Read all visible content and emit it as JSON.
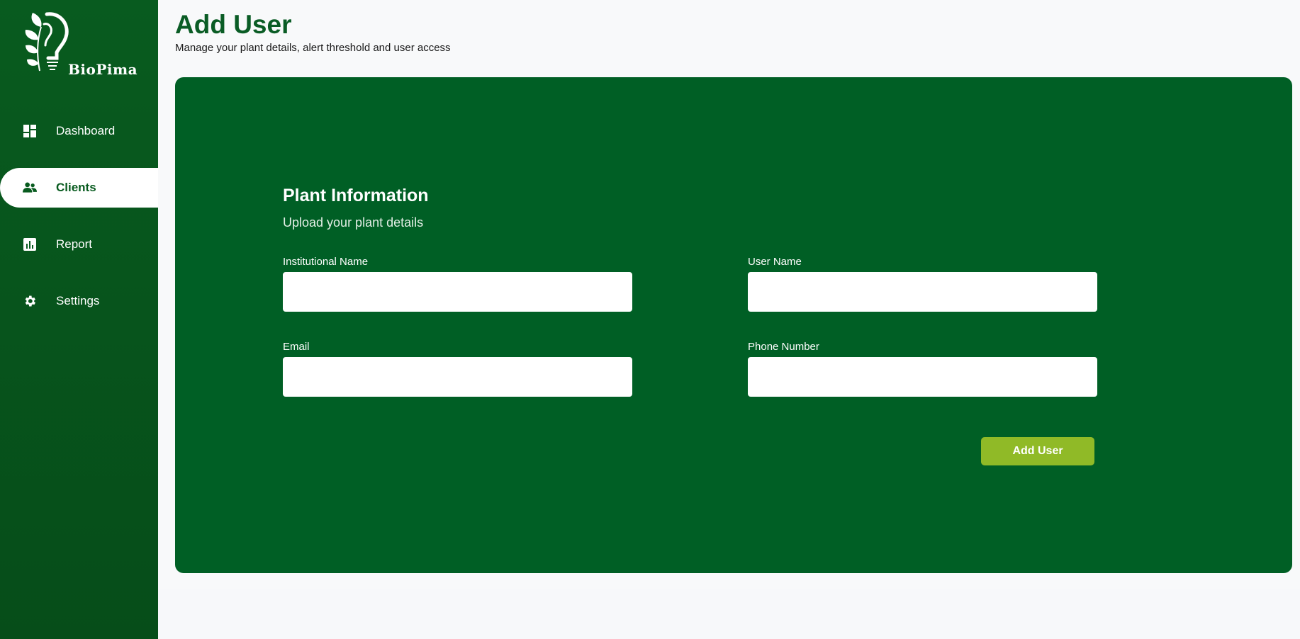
{
  "brand": {
    "name": "BioPima"
  },
  "sidebar": {
    "items": [
      {
        "label": "Dashboard",
        "icon": "dashboard-icon",
        "active": false
      },
      {
        "label": "Clients",
        "icon": "people-icon",
        "active": true
      },
      {
        "label": "Report",
        "icon": "bar-chart-icon",
        "active": false
      },
      {
        "label": "Settings",
        "icon": "gear-icon",
        "active": false
      }
    ]
  },
  "header": {
    "title": "Add User",
    "subtitle": "Manage your plant details, alert threshold and user access"
  },
  "form": {
    "title": "Plant Information",
    "subtitle": "Upload your plant details",
    "fields": [
      {
        "label": "Institutional Name",
        "value": "",
        "placeholder": ""
      },
      {
        "label": "User Name",
        "value": "",
        "placeholder": ""
      },
      {
        "label": "Email",
        "value": "",
        "placeholder": ""
      },
      {
        "label": "Phone Number",
        "value": "",
        "placeholder": ""
      }
    ],
    "submit_label": "Add User"
  },
  "colors": {
    "primary": "#005f25",
    "sidebar": "#085b1f",
    "accent": "#90ba27",
    "title": "#0a5c25"
  }
}
